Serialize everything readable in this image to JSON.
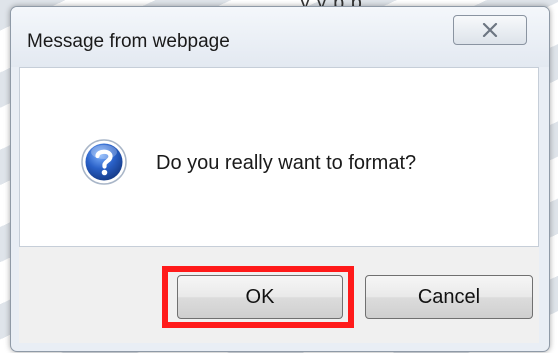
{
  "background": {
    "partial_text": "y     y  p  p"
  },
  "dialog": {
    "title": "Message from webpage",
    "close_icon": "close-x-icon",
    "message_icon": "question-mark-icon",
    "message": "Do you really want to format?",
    "buttons": {
      "ok_label": "OK",
      "cancel_label": "Cancel"
    },
    "highlight_color": "#ff1a1a",
    "icon_color": "#1d4fa8"
  }
}
